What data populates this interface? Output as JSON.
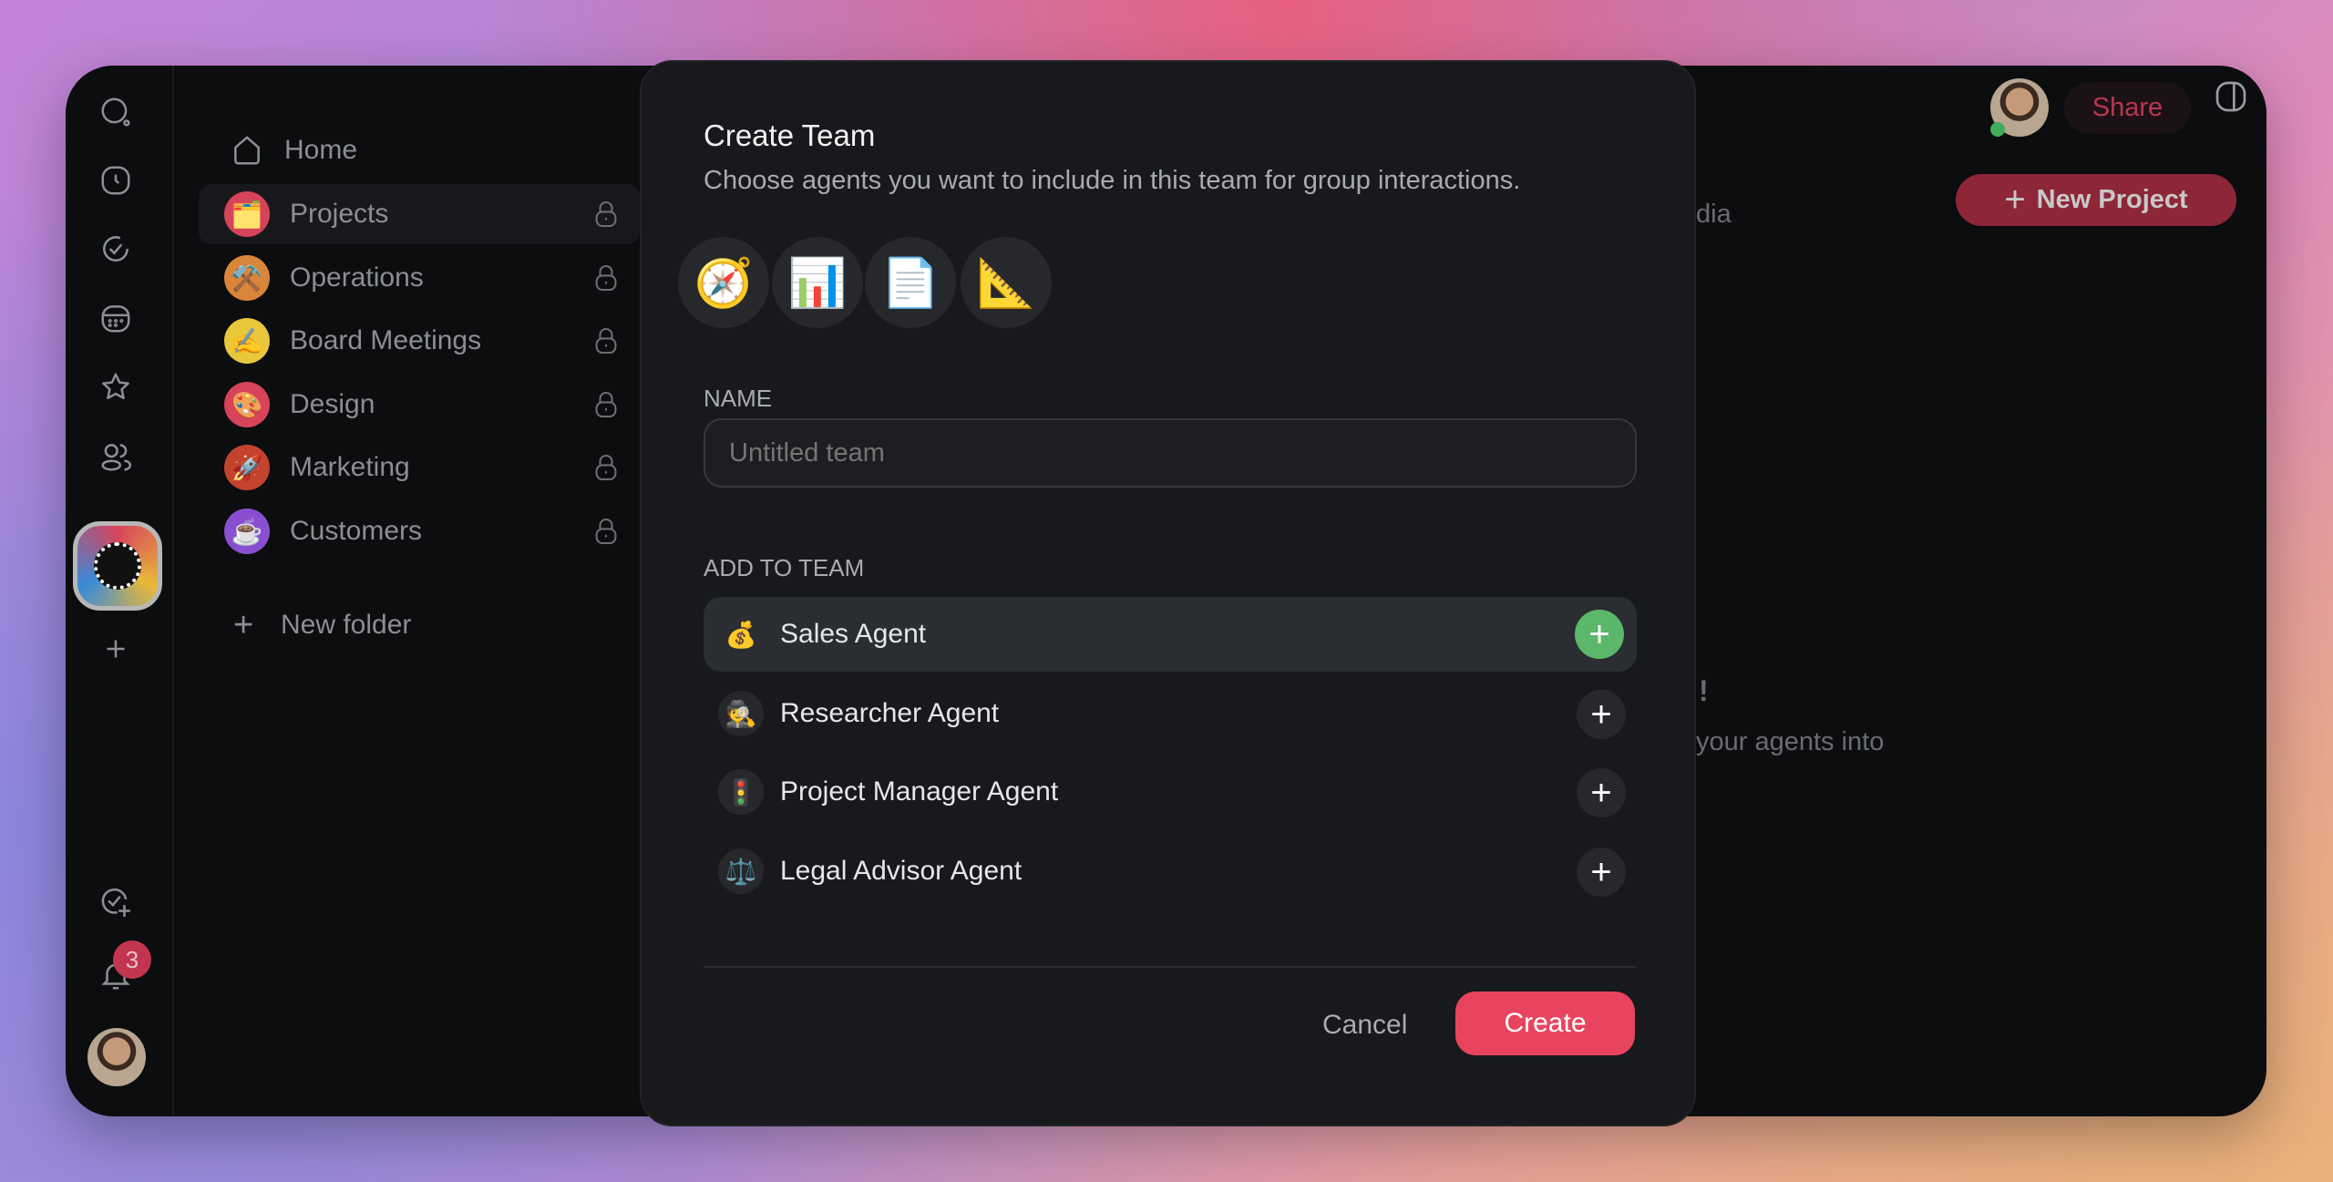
{
  "sidebar": {
    "items": [
      {
        "label": "Home",
        "icon": "home-icon"
      },
      {
        "label": "Projects",
        "emoji": "🗂️",
        "color": "#d8435c",
        "locked": true,
        "selected": true
      },
      {
        "label": "Operations",
        "emoji": "⚒️",
        "color": "#d9853a",
        "locked": true
      },
      {
        "label": "Board Meetings",
        "emoji": "✍️",
        "color": "#e8c83a",
        "locked": true
      },
      {
        "label": "Design",
        "emoji": "🎨",
        "color": "#d8435c",
        "locked": true
      },
      {
        "label": "Marketing",
        "emoji": "🚀",
        "color": "#c4432e",
        "locked": true
      },
      {
        "label": "Customers",
        "emoji": "☕",
        "color": "#8a4fd0",
        "locked": true
      }
    ],
    "new_folder": "New folder"
  },
  "rail": {
    "notifications_count": "3"
  },
  "header": {
    "share": "Share",
    "new_project": "New Project"
  },
  "background_text": {
    "fragment1": "dia",
    "fragment2": "!",
    "fragment3": "your agents into"
  },
  "modal": {
    "title": "Create Team",
    "subtitle": "Choose agents you want to include in this team for group interactions.",
    "team_icons": [
      "🧭",
      "📊",
      "📄",
      "📐"
    ],
    "name_label": "NAME",
    "name_placeholder": "Untitled team",
    "add_label": "ADD TO TEAM",
    "agents": [
      {
        "name": "Sales Agent",
        "emoji": "💰",
        "highlighted": true
      },
      {
        "name": "Researcher Agent",
        "emoji": "🕵️"
      },
      {
        "name": "Project Manager Agent",
        "emoji": "🚦"
      },
      {
        "name": "Legal Advisor Agent",
        "emoji": "⚖️"
      }
    ],
    "cancel": "Cancel",
    "create": "Create"
  },
  "colors": {
    "accent": "#e8445f",
    "add_green": "#5bb86a",
    "online": "#3fae5a"
  }
}
